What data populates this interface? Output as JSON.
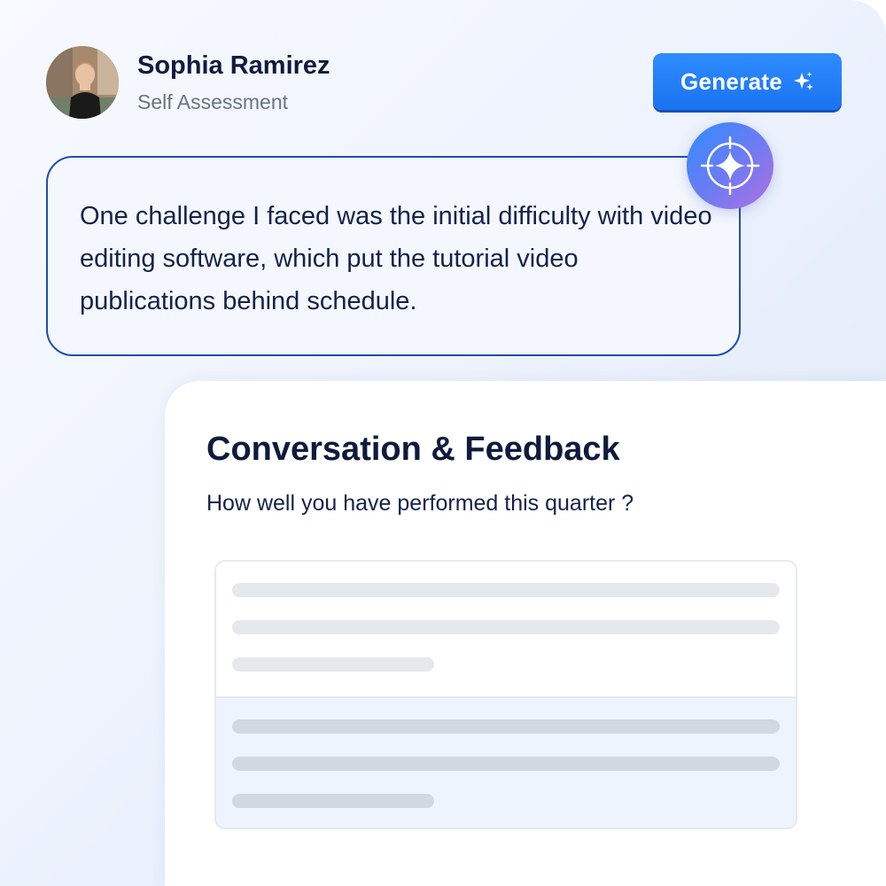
{
  "profile": {
    "name": "Sophia Ramirez",
    "subtitle": "Self Assessment",
    "avatar_icon": "user-photo-avatar"
  },
  "toolbar": {
    "generate_label": "Generate",
    "generate_icon": "sparkle-icon"
  },
  "response": {
    "text": "One challenge I faced was the initial difficulty with video editing software, which put the tutorial video publications behind schedule.",
    "badge_icon": "ai-sparkle-icon"
  },
  "feedback": {
    "title": "Conversation & Feedback",
    "question": "How well you have performed this quarter ?"
  },
  "colors": {
    "accent": "#1a73f0",
    "heading": "#0f1b3d",
    "bubble_border": "#1f4fa8"
  }
}
